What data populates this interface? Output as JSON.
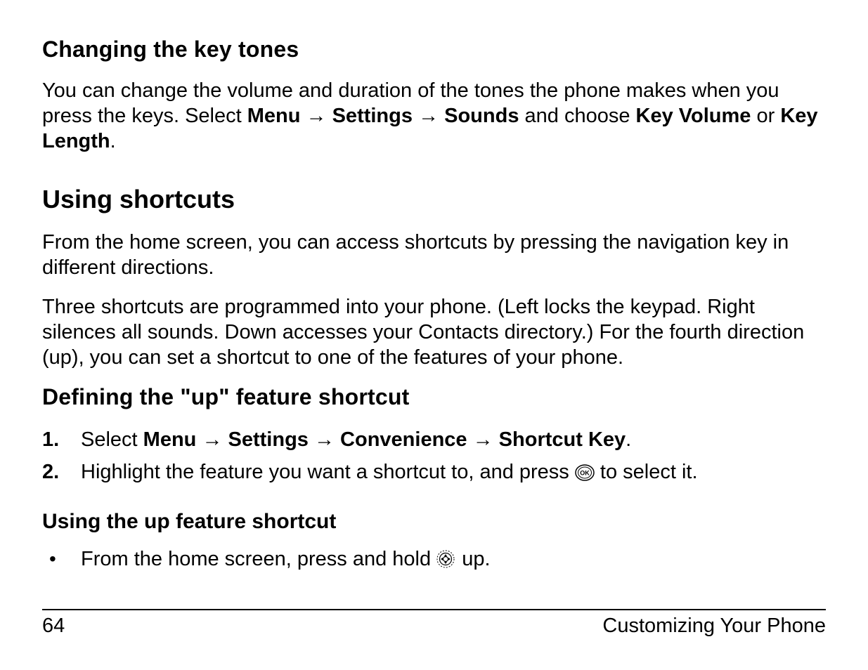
{
  "section1": {
    "heading": "Changing the key tones",
    "para_a": "You can change the volume and duration of the tones the phone makes when you press the keys. Select",
    "menu": "Menu",
    "settings": "Settings",
    "sounds": "Sounds",
    "and_choose": " and choose ",
    "kv": "Key Volume",
    "or": " or ",
    "kl": "Key Length",
    "period": "."
  },
  "section2": {
    "heading": "Using shortcuts",
    "para1": "From the home screen, you can access shortcuts by pressing the navigation key in different directions.",
    "para2": "Three shortcuts are programmed into your phone. (Left locks the keypad. Right silences all sounds. Down accesses your Contacts directory.) For the fourth direction (up), you can set a shortcut to one of the features of your phone."
  },
  "section3": {
    "heading": "Defining the \"up\" feature shortcut",
    "step1_a": "Select ",
    "menu": "Menu",
    "settings": "Settings",
    "convenience": "Convenience",
    "shortcut_key": "Shortcut Key",
    "step1_end": ".",
    "step2_a": "Highlight the feature you want a shortcut to, and press ",
    "step2_b": " to select it."
  },
  "section4": {
    "heading": "Using the up feature shortcut",
    "bullet_a": "From the home screen, press and hold ",
    "bullet_b": " up."
  },
  "glyphs": {
    "arrow": "→"
  },
  "footer": {
    "page": "64",
    "title": "Customizing Your Phone"
  }
}
